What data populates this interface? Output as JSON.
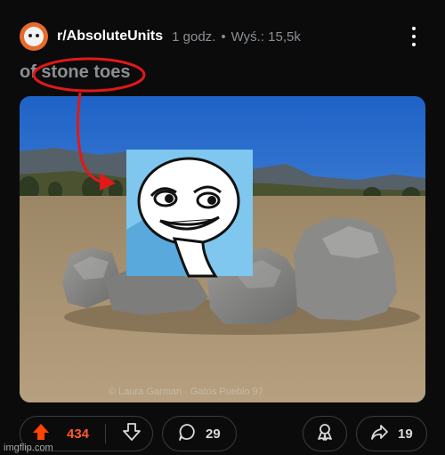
{
  "post": {
    "subreddit": "r/AbsoluteUnits",
    "time": "1 godz.",
    "separator": "•",
    "views": "Wyś.: 15,5k",
    "title": "of stone toes",
    "image_caption": "© Laura Garman · Gatos Pueblo 97"
  },
  "actions": {
    "score": "434",
    "comments": "29",
    "shares": "19"
  },
  "icons": {
    "avatar": "snoo-avatar-icon",
    "more": "more-options-icon",
    "upvote": "upvote-arrow-icon",
    "downvote": "downvote-arrow-icon",
    "comment": "comment-bubble-icon",
    "award": "award-icon",
    "share": "share-arrow-icon"
  },
  "colors": {
    "background": "#0b0b0c",
    "accent_upvote": "#ff4500",
    "annotation_red": "#e01919",
    "muted_text": "#8b8f92"
  },
  "watermark": "imgflip.com"
}
